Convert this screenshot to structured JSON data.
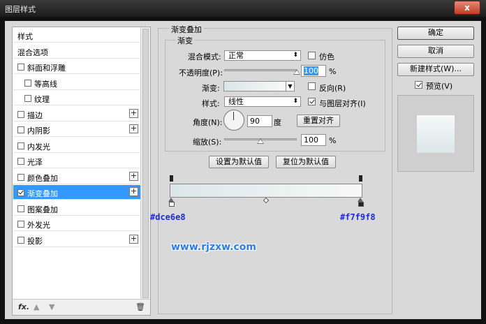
{
  "window": {
    "title": "图层样式",
    "close_label": "x"
  },
  "left_panel": {
    "items": [
      {
        "label": "样式",
        "checkbox": false,
        "checked": false,
        "plus": false,
        "selected": false,
        "indent": 0
      },
      {
        "label": "混合选项",
        "checkbox": false,
        "checked": false,
        "plus": false,
        "selected": false,
        "indent": 0
      },
      {
        "label": "斜面和浮雕",
        "checkbox": true,
        "checked": false,
        "plus": false,
        "selected": false,
        "indent": 0
      },
      {
        "label": "等高线",
        "checkbox": true,
        "checked": false,
        "plus": false,
        "selected": false,
        "indent": 1
      },
      {
        "label": "纹理",
        "checkbox": true,
        "checked": false,
        "plus": false,
        "selected": false,
        "indent": 1
      },
      {
        "label": "描边",
        "checkbox": true,
        "checked": false,
        "plus": true,
        "selected": false,
        "indent": 0
      },
      {
        "label": "内阴影",
        "checkbox": true,
        "checked": false,
        "plus": true,
        "selected": false,
        "indent": 0
      },
      {
        "label": "内发光",
        "checkbox": true,
        "checked": false,
        "plus": false,
        "selected": false,
        "indent": 0
      },
      {
        "label": "光泽",
        "checkbox": true,
        "checked": false,
        "plus": false,
        "selected": false,
        "indent": 0
      },
      {
        "label": "颜色叠加",
        "checkbox": true,
        "checked": false,
        "plus": true,
        "selected": false,
        "indent": 0
      },
      {
        "label": "渐变叠加",
        "checkbox": true,
        "checked": true,
        "plus": true,
        "selected": true,
        "indent": 0
      },
      {
        "label": "图案叠加",
        "checkbox": true,
        "checked": false,
        "plus": false,
        "selected": false,
        "indent": 0
      },
      {
        "label": "外发光",
        "checkbox": true,
        "checked": false,
        "plus": false,
        "selected": false,
        "indent": 0
      },
      {
        "label": "投影",
        "checkbox": true,
        "checked": false,
        "plus": true,
        "selected": false,
        "indent": 0
      }
    ],
    "bottom": {
      "fx_label": "fx.",
      "up_icon": "arrow-up-icon",
      "down_icon": "arrow-down-icon",
      "delete_icon": "trash-icon"
    }
  },
  "gradient_overlay": {
    "section_title": "渐变叠加",
    "subsection_title": "渐变",
    "blend_mode": {
      "label": "混合模式:",
      "value": "正常"
    },
    "dither": {
      "label": "仿色",
      "checked": false
    },
    "opacity": {
      "label": "不透明度(P):",
      "value": "100",
      "unit": "%",
      "slider_fraction": 1.0
    },
    "gradient": {
      "label": "渐变:"
    },
    "reverse": {
      "label": "反向(R)",
      "checked": false
    },
    "style": {
      "label": "样式:",
      "value": "线性"
    },
    "align_layer": {
      "label": "与图层对齐(I)",
      "checked": true
    },
    "angle": {
      "label": "角度(N):",
      "value": "90",
      "unit": "度"
    },
    "reset_align": {
      "label": "重置对齐"
    },
    "scale": {
      "label": "缩放(S):",
      "value": "100",
      "unit": "%",
      "slider_fraction": 0.5
    },
    "set_default": "设置为默认值",
    "reset_default": "复位为默认值"
  },
  "gradient_bar": {
    "left_color_label": "#dce6e8",
    "right_color_label": "#f7f9f8",
    "start_color": "#dce6e8",
    "end_color": "#f7f9f8",
    "label_color": "#1f2bd8"
  },
  "watermark": {
    "text": "www.rjzxw.com"
  },
  "right_panel": {
    "ok": "确定",
    "cancel": "取消",
    "new_style": "新建样式(W)...",
    "preview": {
      "label": "预览(V)",
      "checked": true
    }
  }
}
